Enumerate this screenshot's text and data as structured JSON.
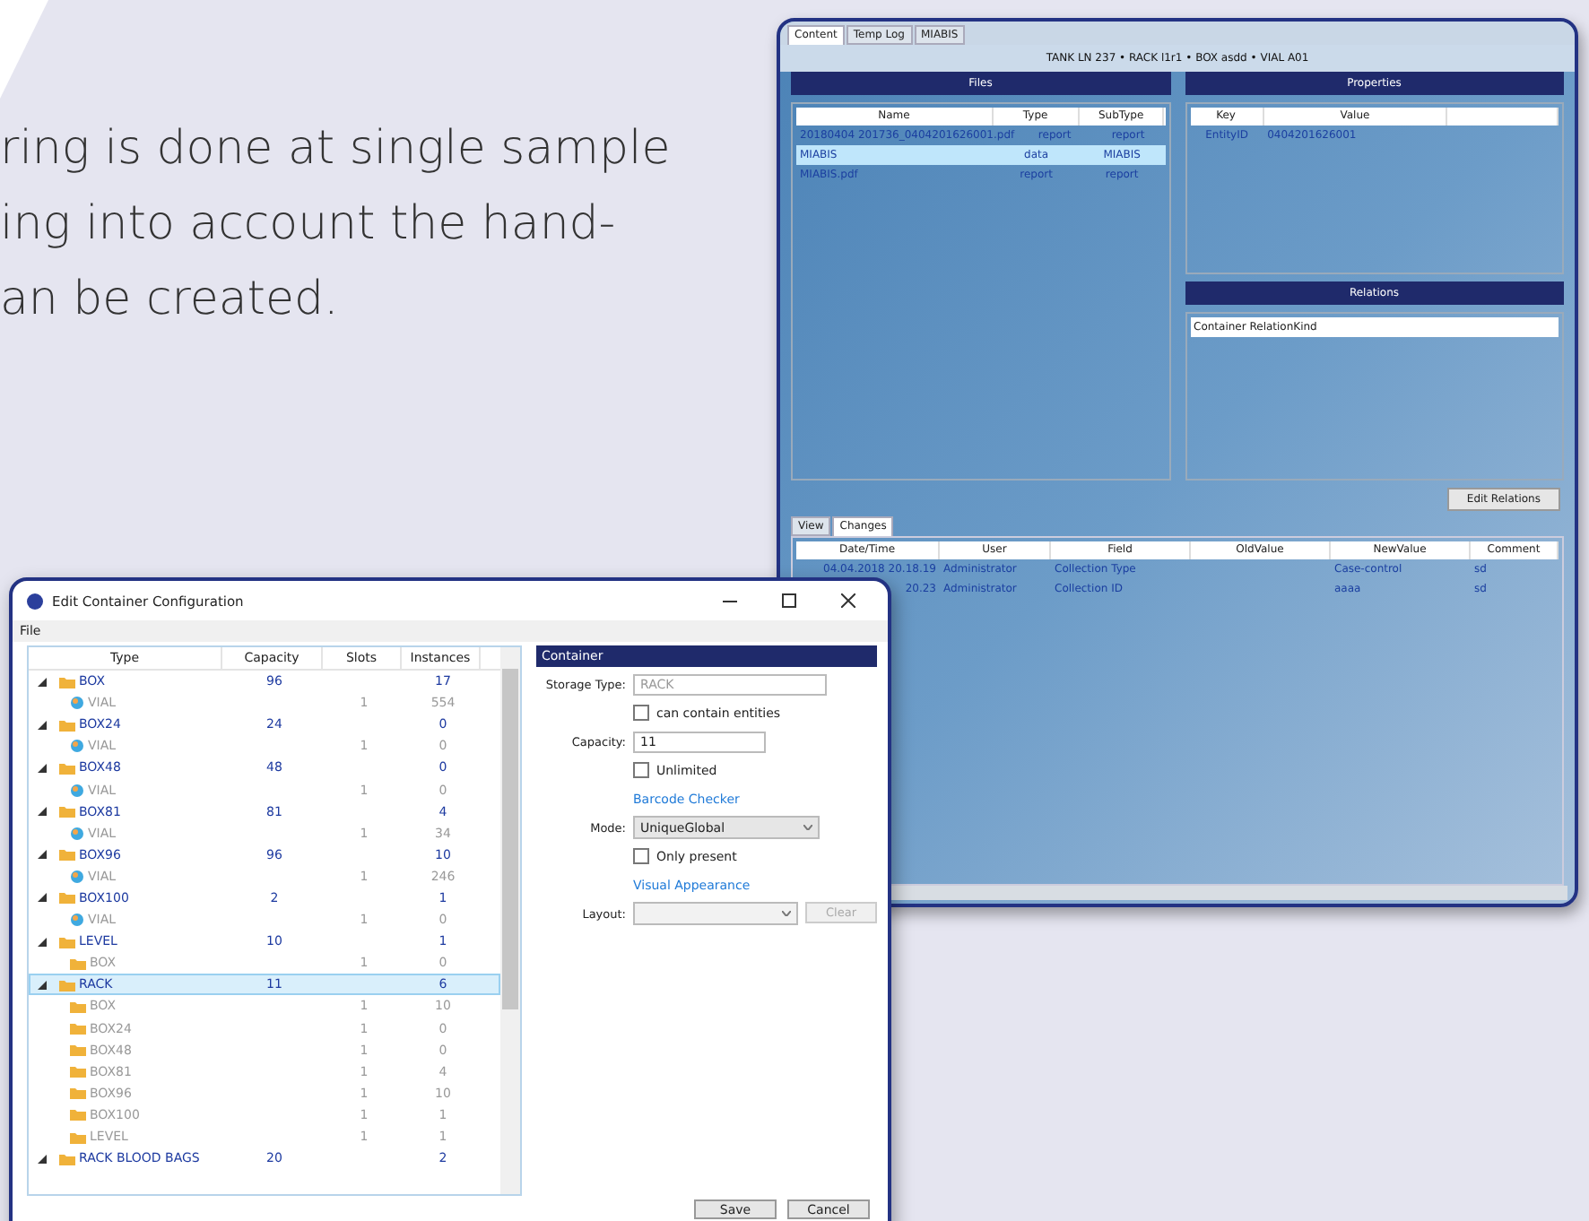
{
  "intro_lines": [
    "ring is done at single sample",
    "ing into account the hand-",
    "an be created."
  ],
  "main_window": {
    "tabs": [
      {
        "label": "Content",
        "selected": true
      },
      {
        "label": "Temp Log",
        "selected": false
      },
      {
        "label": "MIABIS",
        "selected": false
      }
    ],
    "breadcrumb": "TANK LN 237 • RACK l1r1 • BOX asdd • VIAL A01",
    "files": {
      "title": "Files",
      "columns": [
        "Name",
        "Type",
        "SubType"
      ],
      "rows": [
        {
          "cells": [
            "20180404 201736_0404201626001.pdf",
            "report",
            "report"
          ],
          "selected": false
        },
        {
          "cells": [
            "MIABIS",
            "data",
            "MIABIS"
          ],
          "selected": true
        },
        {
          "cells": [
            "MIABIS.pdf",
            "report",
            "report"
          ],
          "selected": false
        }
      ]
    },
    "properties": {
      "title": "Properties",
      "columns": [
        "Key",
        "Value"
      ],
      "rows": [
        [
          "EntityID",
          "0404201626001"
        ]
      ]
    },
    "relations": {
      "title": "Relations",
      "rows": [
        "Container RelationKind"
      ]
    },
    "edit_button": "Edit Relations",
    "bottom_tabs": [
      {
        "label": "View",
        "selected": false
      },
      {
        "label": "Changes",
        "selected": true
      }
    ],
    "changes": {
      "columns": [
        "Date/Time",
        "User",
        "Field",
        "OldValue",
        "NewValue",
        "Comment"
      ],
      "rows": [
        [
          "04.04.2018 20.18.19",
          "Administrator",
          "Collection Type",
          "",
          "Case-control",
          "sd"
        ],
        [
          "20.23",
          "Administrator",
          "Collection ID",
          "",
          "aaaa",
          "sd"
        ]
      ]
    }
  },
  "dialog": {
    "title": "Edit Container Configuration",
    "menu": [
      "File"
    ],
    "tree_columns": [
      "Type",
      "Capacity",
      "Slots",
      "Instances"
    ],
    "tree": [
      {
        "label": "BOX",
        "kind": "container",
        "capacity": "96",
        "instances": "17",
        "expanded": true,
        "selected": false,
        "children": [
          {
            "label": "VIAL",
            "kind": "vial",
            "slots": "1",
            "instances": "554"
          }
        ]
      },
      {
        "label": "BOX24",
        "kind": "container",
        "capacity": "24",
        "instances": "0",
        "expanded": true,
        "selected": false,
        "children": [
          {
            "label": "VIAL",
            "kind": "vial",
            "slots": "1",
            "instances": "0"
          }
        ]
      },
      {
        "label": "BOX48",
        "kind": "container",
        "capacity": "48",
        "instances": "0",
        "expanded": true,
        "selected": false,
        "children": [
          {
            "label": "VIAL",
            "kind": "vial",
            "slots": "1",
            "instances": "0"
          }
        ]
      },
      {
        "label": "BOX81",
        "kind": "container",
        "capacity": "81",
        "instances": "4",
        "expanded": true,
        "selected": false,
        "children": [
          {
            "label": "VIAL",
            "kind": "vial",
            "slots": "1",
            "instances": "34"
          }
        ]
      },
      {
        "label": "BOX96",
        "kind": "container",
        "capacity": "96",
        "instances": "10",
        "expanded": true,
        "selected": false,
        "children": [
          {
            "label": "VIAL",
            "kind": "vial",
            "slots": "1",
            "instances": "246"
          }
        ]
      },
      {
        "label": "BOX100",
        "kind": "container",
        "capacity": "2",
        "instances": "1",
        "expanded": true,
        "selected": false,
        "children": [
          {
            "label": "VIAL",
            "kind": "vial",
            "slots": "1",
            "instances": "0"
          }
        ]
      },
      {
        "label": "LEVEL",
        "kind": "container",
        "capacity": "10",
        "instances": "1",
        "expanded": true,
        "selected": false,
        "children": [
          {
            "label": "BOX",
            "kind": "container",
            "slots": "1",
            "instances": "0"
          }
        ]
      },
      {
        "label": "RACK",
        "kind": "container",
        "capacity": "11",
        "instances": "6",
        "expanded": true,
        "selected": true,
        "children": [
          {
            "label": "BOX",
            "kind": "container",
            "slots": "1",
            "instances": "10"
          },
          {
            "label": "BOX24",
            "kind": "container",
            "slots": "1",
            "instances": "0"
          },
          {
            "label": "BOX48",
            "kind": "container",
            "slots": "1",
            "instances": "0"
          },
          {
            "label": "BOX81",
            "kind": "container",
            "slots": "1",
            "instances": "4"
          },
          {
            "label": "BOX96",
            "kind": "container",
            "slots": "1",
            "instances": "10"
          },
          {
            "label": "BOX100",
            "kind": "container",
            "slots": "1",
            "instances": "1"
          },
          {
            "label": "LEVEL",
            "kind": "container",
            "slots": "1",
            "instances": "1"
          }
        ]
      },
      {
        "label": "RACK BLOOD BAGS",
        "kind": "container",
        "capacity": "20",
        "instances": "2",
        "expanded": true,
        "selected": false
      }
    ],
    "panel": {
      "title": "Container",
      "fields": [
        {
          "kind": "text",
          "label": "Storage Type:",
          "value": "RACK",
          "disabled": true
        },
        {
          "kind": "checkbox",
          "label": "can contain entities",
          "checked": false
        },
        {
          "kind": "text",
          "label": "Capacity:",
          "value": "11",
          "disabled": false
        },
        {
          "kind": "checkbox",
          "label": "Unlimited",
          "checked": false
        },
        {
          "kind": "link",
          "label": "Barcode Checker"
        },
        {
          "kind": "select",
          "label": "Mode:",
          "value": "UniqueGlobal",
          "disabled": false
        },
        {
          "kind": "checkbox",
          "label": "Only present",
          "checked": false
        },
        {
          "kind": "link",
          "label": "Visual Appearance"
        },
        {
          "kind": "select",
          "label": "Layout:",
          "disabled": true,
          "button": "Clear"
        }
      ]
    },
    "buttons": [
      "Save",
      "Cancel"
    ]
  }
}
